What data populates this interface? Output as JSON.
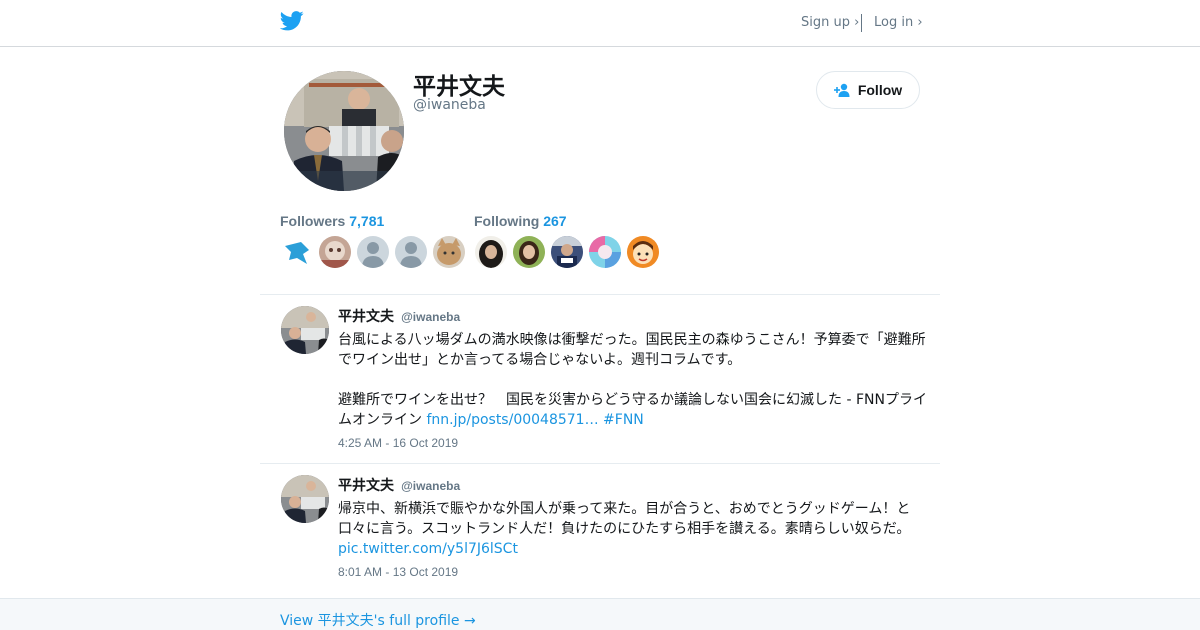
{
  "colors": {
    "accent": "#1b95e0",
    "muted": "#657786",
    "text": "#14171a",
    "twitter_blue": "#1da1f2"
  },
  "header": {
    "logo_icon": "twitter-bird-icon",
    "signup_label": "Sign up ›",
    "login_label": "Log in ›"
  },
  "profile": {
    "name": "平井文夫",
    "handle": "@iwaneba",
    "follow_label": "Follow",
    "follow_icon": "add-user-icon"
  },
  "stats": {
    "followers_label": "Followers",
    "followers_count": "7,781",
    "following_label": "Following",
    "following_count": "267"
  },
  "tweets": [
    {
      "name": "平井文夫",
      "handle": "@iwaneba",
      "text_p1": "台風による八ッ場ダムの満水映像は衝撃だった。国民民主の森ゆうこさん！予算委で「避難所でワイン出せ」とか言ってる場合じゃないよ。週刊コラムです。",
      "text_p2": "避難所でワインを出せ？　国民を災害からどう守るか議論しない国会に幻滅した - FNNプライムオンライン",
      "link": "fnn.jp/posts/00048571…",
      "hashtag": "#FNN",
      "time": "4:25 AM - 16 Oct 2019"
    },
    {
      "name": "平井文夫",
      "handle": "@iwaneba",
      "text_p1": "帰京中、新横浜で賑やかな外国人が乗って来た。目が合うと、おめでとうグッドゲーム！と口々に言う。スコットランド人だ！負けたのにひたすら相手を讃える。素晴らしい奴らだ。",
      "link": "pic.twitter.com/y5l7J6lSCt",
      "time": "8:01 AM - 13 Oct 2019"
    }
  ],
  "footer": {
    "profile_link": "View 平井文夫's full profile →"
  }
}
